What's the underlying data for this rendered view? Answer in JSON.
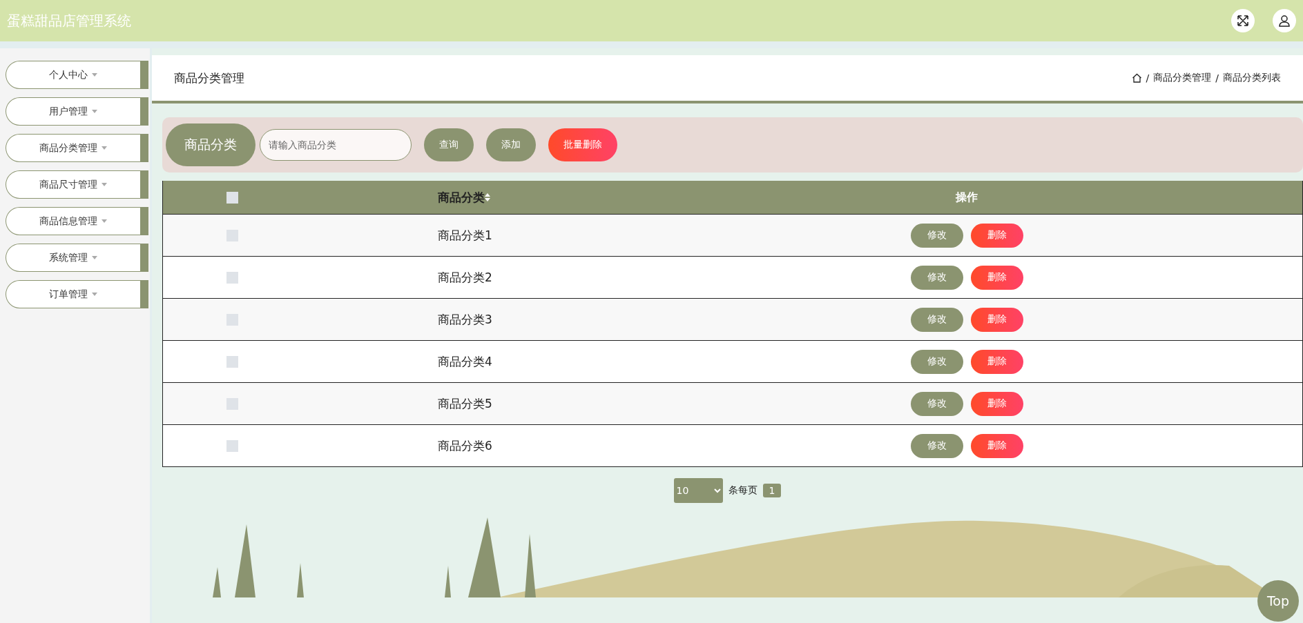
{
  "header": {
    "title": "蛋糕甜品店管理系统"
  },
  "sidebar": {
    "items": [
      {
        "label": "个人中心",
        "expanded": false
      },
      {
        "label": "用户管理",
        "expanded": false
      },
      {
        "label": "商品分类管理",
        "expanded": false
      },
      {
        "label": "商品尺寸管理",
        "expanded": false
      },
      {
        "label": "商品信息管理",
        "expanded": false
      },
      {
        "label": "系统管理",
        "expanded": false
      },
      {
        "label": "订单管理",
        "expanded": false
      }
    ]
  },
  "page_title": "商品分类管理",
  "breadcrumb": [
    {
      "separator": "/",
      "label": "商品分类管理"
    },
    {
      "separator": "/",
      "label": "商品分类列表"
    }
  ],
  "search": {
    "label": "商品分类",
    "placeholder": "请输入商品分类",
    "buttons": [
      {
        "label": "查询",
        "kind": "normal"
      },
      {
        "label": "添加",
        "kind": "normal"
      },
      {
        "label": "批量删除",
        "kind": "danger"
      }
    ]
  },
  "table": {
    "select_all": {
      "checked": false
    },
    "columns": [
      "商品分类",
      "操作"
    ],
    "rows": [
      {
        "checked": false,
        "category": "商品分类1",
        "actions": [
          {
            "label": "修改",
            "kind": "normal"
          },
          {
            "label": "删除",
            "kind": "danger"
          }
        ]
      },
      {
        "checked": false,
        "category": "商品分类2",
        "actions": [
          {
            "label": "修改",
            "kind": "normal"
          },
          {
            "label": "删除",
            "kind": "danger"
          }
        ]
      },
      {
        "checked": false,
        "category": "商品分类3",
        "actions": [
          {
            "label": "修改",
            "kind": "normal"
          },
          {
            "label": "删除",
            "kind": "danger"
          }
        ]
      },
      {
        "checked": false,
        "category": "商品分类4",
        "actions": [
          {
            "label": "修改",
            "kind": "normal"
          },
          {
            "label": "删除",
            "kind": "danger"
          }
        ]
      },
      {
        "checked": false,
        "category": "商品分类5",
        "actions": [
          {
            "label": "修改",
            "kind": "normal"
          },
          {
            "label": "删除",
            "kind": "danger"
          }
        ]
      },
      {
        "checked": false,
        "category": "商品分类6",
        "actions": [
          {
            "label": "修改",
            "kind": "normal"
          },
          {
            "label": "删除",
            "kind": "danger"
          }
        ]
      }
    ]
  },
  "pagination": {
    "page_size": "10",
    "page_size_label": "条每页",
    "pages": [
      {
        "label": "1",
        "selected": true
      }
    ]
  },
  "top_button": "Top"
}
